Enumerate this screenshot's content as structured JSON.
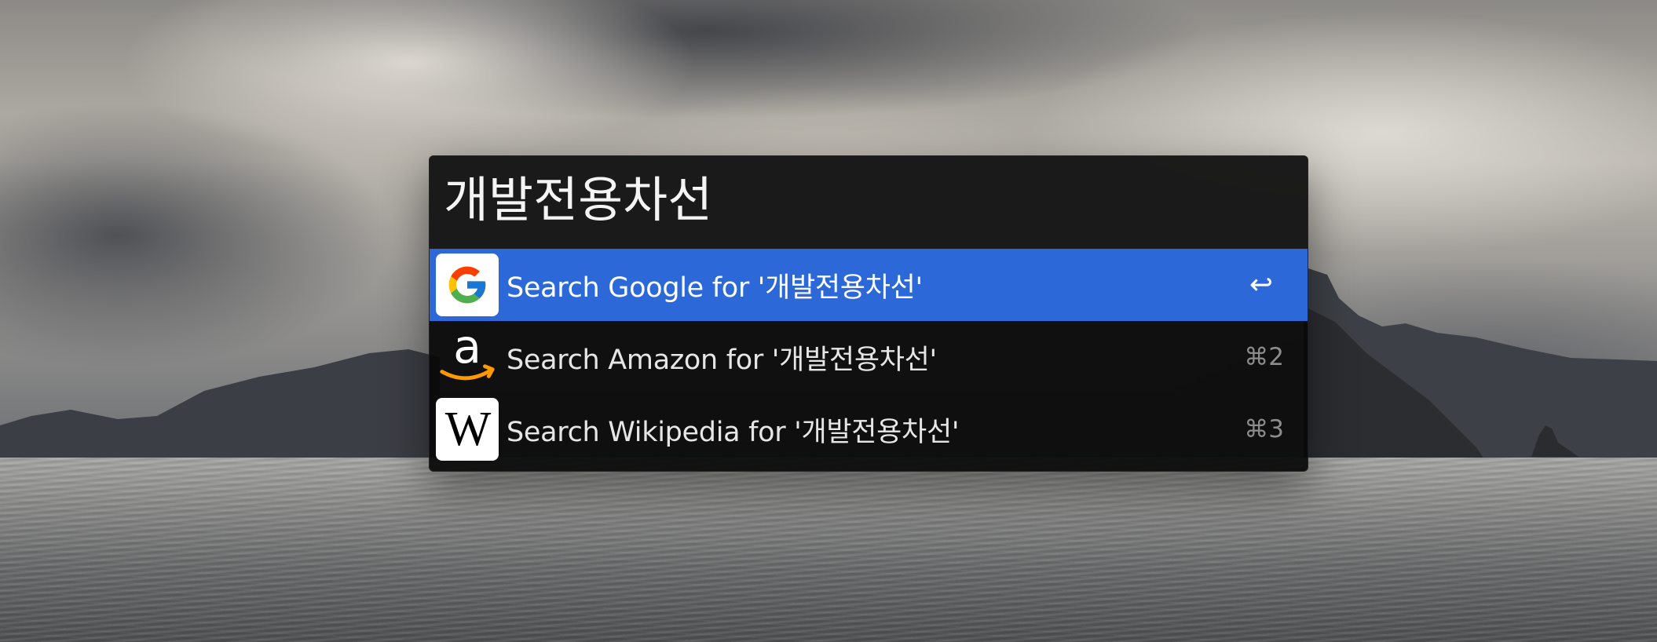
{
  "launcher": {
    "query": "개발전용차선",
    "results": [
      {
        "label": "Search Google for '개발전용차선'",
        "shortcut": "↩",
        "icon": "google-icon",
        "selected": true
      },
      {
        "label": "Search Amazon for '개발전용차선'",
        "shortcut": "⌘2",
        "icon": "amazon-icon",
        "selected": false
      },
      {
        "label": "Search Wikipedia for '개발전용차선'",
        "shortcut": "⌘3",
        "icon": "wikipedia-icon",
        "selected": false
      }
    ],
    "selection_color": "#2c68d8",
    "panel_color": "#080808"
  },
  "icons": {
    "wikipedia_glyph": "W"
  }
}
